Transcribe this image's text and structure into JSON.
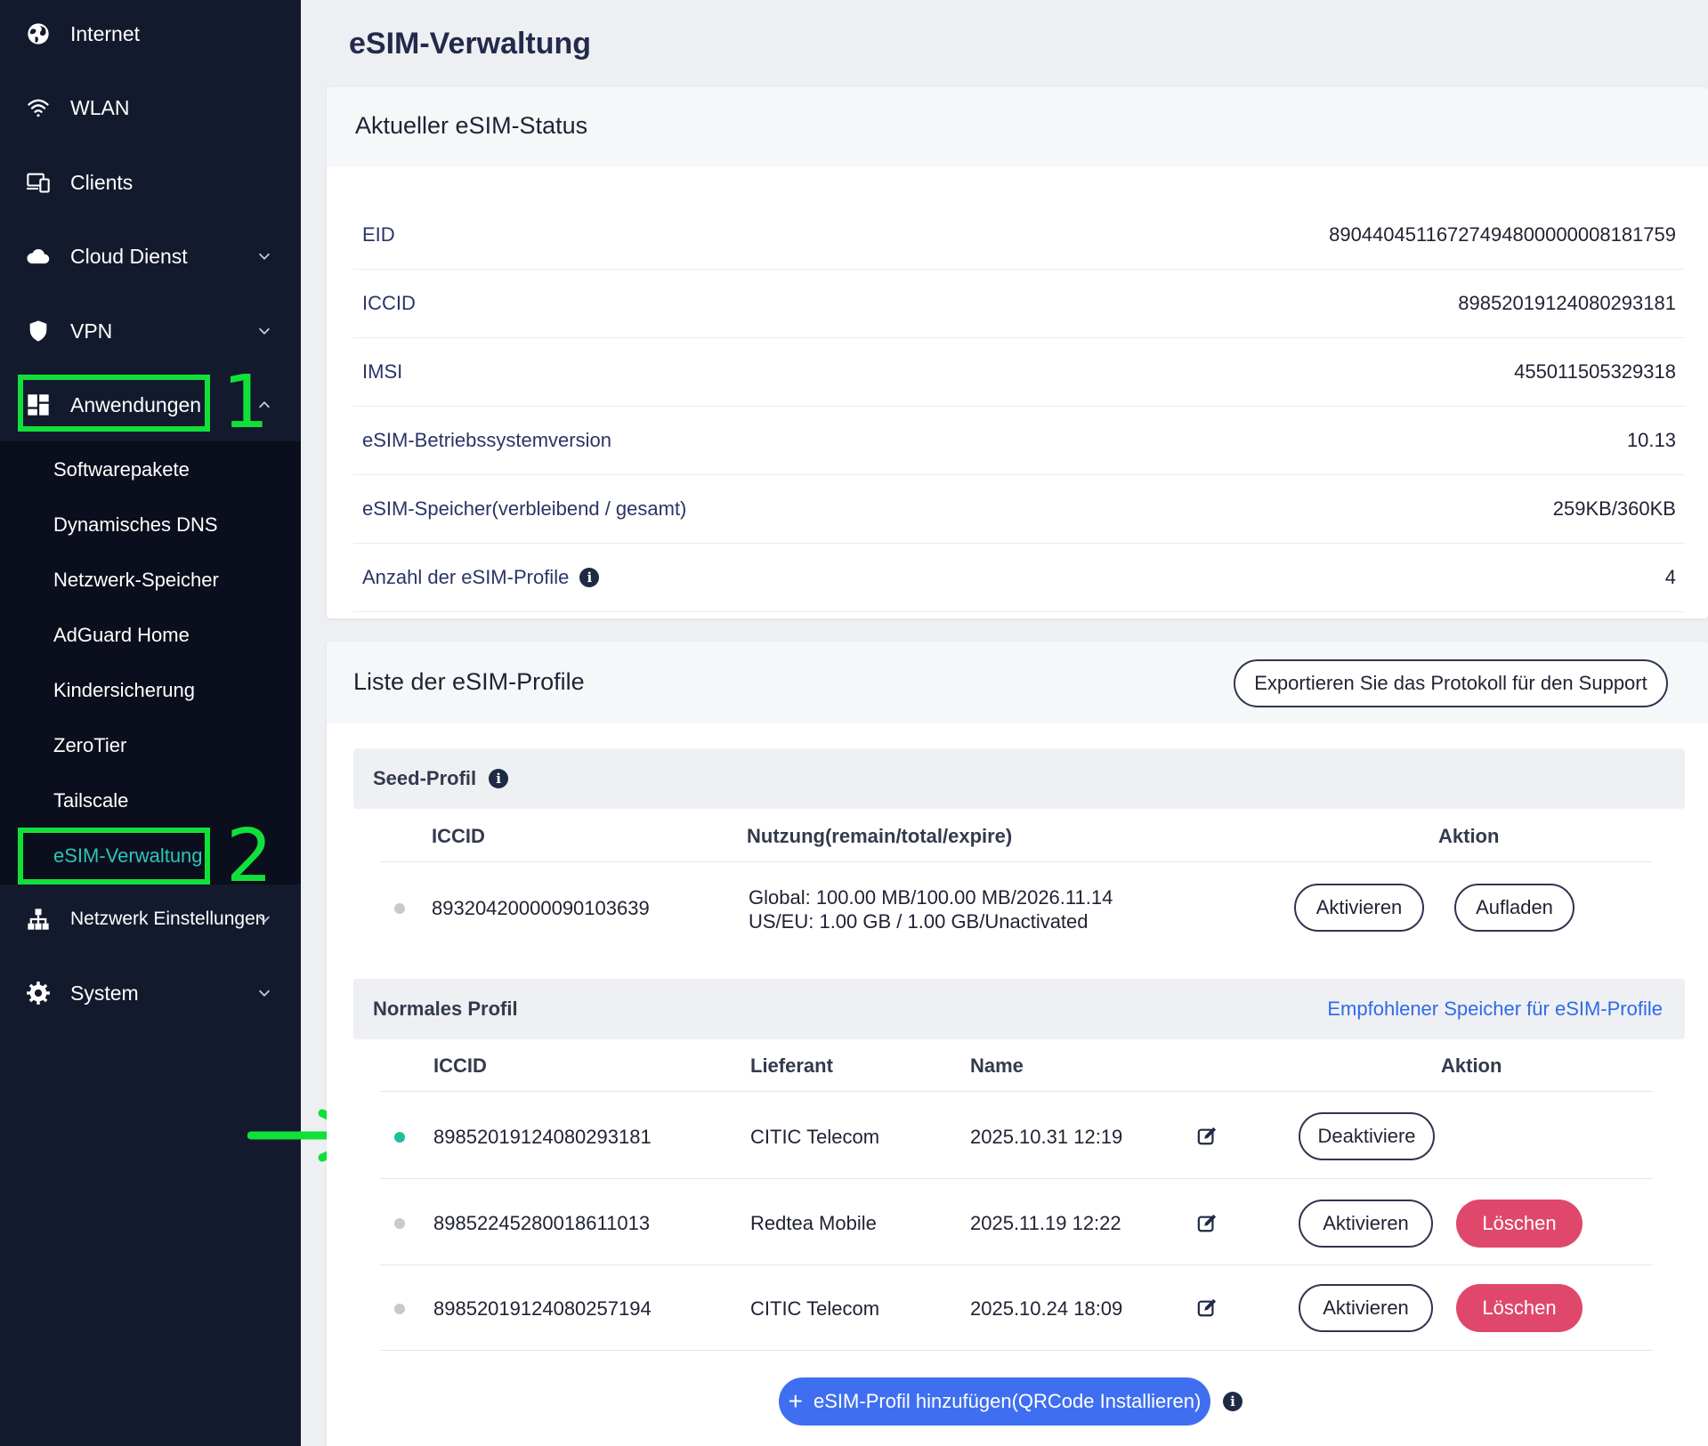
{
  "sidebar": {
    "items": [
      {
        "label": "Internet",
        "icon": "globe-icon"
      },
      {
        "label": "WLAN",
        "icon": "wifi-icon"
      },
      {
        "label": "Clients",
        "icon": "devices-icon"
      },
      {
        "label": "Cloud Dienst",
        "icon": "cloud-icon"
      },
      {
        "label": "VPN",
        "icon": "shield-icon"
      },
      {
        "label": "Anwendungen",
        "icon": "apps-grid-icon"
      },
      {
        "label": "Netzwerk Einstellungen",
        "icon": "network-icon"
      },
      {
        "label": "System",
        "icon": "gear-icon"
      }
    ],
    "sub_items": [
      "Softwarepakete",
      "Dynamisches DNS",
      "Netzwerk-Speicher",
      "AdGuard Home",
      "Kindersicherung",
      "ZeroTier",
      "Tailscale",
      "eSIM-Verwaltung"
    ],
    "annotations": {
      "marker_1": "1",
      "marker_2": "2"
    }
  },
  "page": {
    "title": "eSIM-Verwaltung"
  },
  "status_card": {
    "title": "Aktueller eSIM-Status",
    "rows": [
      {
        "label": "EID",
        "value": "89044045116727494800000008181759"
      },
      {
        "label": "ICCID",
        "value": "8985201912408029318​1"
      },
      {
        "label": "IMSI",
        "value": "455011505329318"
      },
      {
        "label": "eSIM-Betriebssystemversion",
        "value": "10.13"
      },
      {
        "label": "eSIM-Speicher(verbleibend / gesamt)",
        "value": "259KB/360KB"
      },
      {
        "label": "Anzahl der eSIM-Profile",
        "value": "4"
      }
    ]
  },
  "profiles_card": {
    "title": "Liste der eSIM-Profile",
    "export_button": "Exportieren Sie das Protokoll für den Support",
    "seed": {
      "title": "Seed-Profil",
      "headers": {
        "iccid": "ICCID",
        "usage": "Nutzung(remain/total/expire)",
        "action": "Aktion"
      },
      "row": {
        "iccid": "89320420000090103639",
        "usage_line1": "Global: 100.00 MB/100.00 MB/2026.11.14",
        "usage_line2": "US/EU: 1.00 GB / 1.00 GB/Unactivated",
        "btn_activate": "Aktivieren",
        "btn_topup": "Aufladen"
      }
    },
    "normal": {
      "title": "Normales Profil",
      "link": "Empfohlener Speicher für eSIM-Profile",
      "headers": {
        "iccid": "ICCID",
        "provider": "Lieferant",
        "name": "Name",
        "action": "Aktion"
      },
      "rows": [
        {
          "iccid": "89852019124080293181",
          "provider": "CITIC Telecom",
          "name": "2025.10.31 12:19",
          "btn_primary": "Deaktiviere",
          "status": "active"
        },
        {
          "iccid": "89852245280018611013",
          "provider": "Redtea Mobile",
          "name": "2025.11.19 12:22",
          "btn_primary": "Aktivieren",
          "btn_delete": "Löschen",
          "status": "inactive"
        },
        {
          "iccid": "89852019124080257194",
          "provider": "CITIC Telecom",
          "name": "2025.10.24 18:09",
          "btn_primary": "Aktivieren",
          "btn_delete": "Löschen",
          "status": "inactive"
        }
      ]
    },
    "add_button": "eSIM-Profil hinzufügen(QRCode Installieren)"
  },
  "colors": {
    "sidebar_bg": "#141a2e",
    "submenu_bg": "#0b0f1d",
    "active_teal": "#2ec4b6",
    "highlight_green": "#12e03a",
    "danger": "#e0486b",
    "primary": "#3f6ff0",
    "link": "#2f6be6"
  }
}
